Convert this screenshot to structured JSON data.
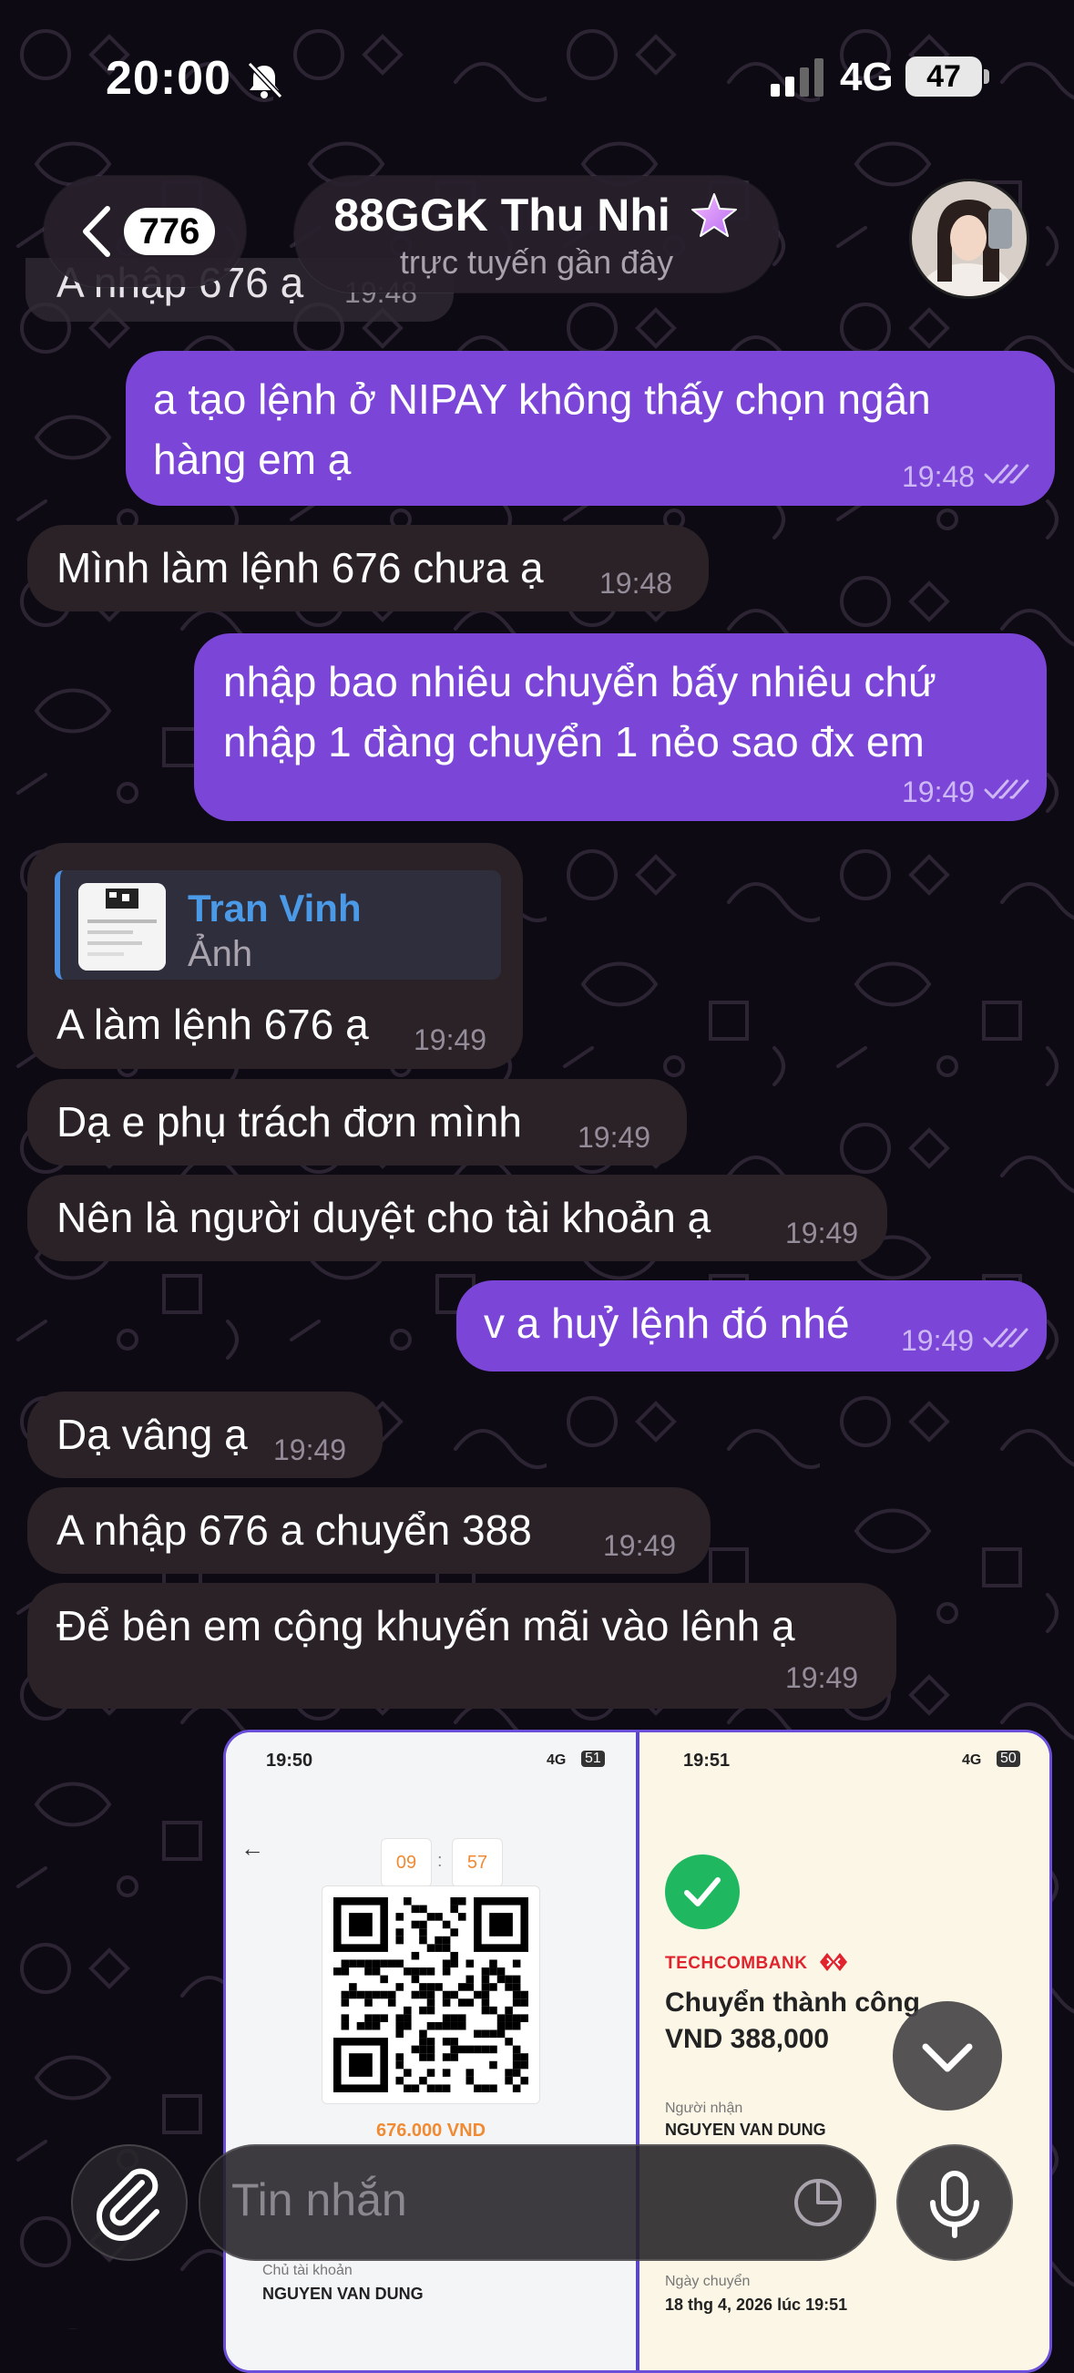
{
  "status_bar": {
    "time": "20:00",
    "network": "4G",
    "battery": "47"
  },
  "header": {
    "back_badge": "776",
    "title": "88GGK Thu Nhi",
    "subtitle": "trực tuyến gần đây"
  },
  "ghost_message": {
    "text": "A nhập 676 ạ",
    "time": "19:48"
  },
  "messages": [
    {
      "direction": "out",
      "line1": "a tạo lệnh ở NIPAY không thấy chọn ngân",
      "line2": "hàng em ạ",
      "time": "19:48"
    },
    {
      "direction": "in",
      "text": "Mình làm lệnh 676 chưa ạ",
      "time": "19:48"
    },
    {
      "direction": "out",
      "line1": "nhập bao nhiêu chuyển bấy nhiêu chứ",
      "line2": "nhập 1 đàng chuyển 1 nẻo sao đx em",
      "time": "19:49"
    },
    {
      "direction": "in",
      "text": "A làm lệnh 676 ạ",
      "time": "19:49",
      "reply": {
        "name": "Tran Vinh",
        "kind": "Ảnh"
      }
    },
    {
      "direction": "in",
      "text": "Dạ e phụ trách đơn mình",
      "time": "19:49"
    },
    {
      "direction": "in",
      "text": "Nên là người duyệt cho tài khoản ạ",
      "time": "19:49"
    },
    {
      "direction": "out",
      "text": "v a huỷ lệnh đó nhé",
      "time": "19:49"
    },
    {
      "direction": "in",
      "text": "Dạ vâng ạ",
      "time": "19:49"
    },
    {
      "direction": "in",
      "text": "A nhập 676 a chuyển 388",
      "time": "19:49"
    },
    {
      "direction": "in",
      "text": "Để bên em cộng khuyến mãi vào lênh ạ",
      "time": "19:49"
    }
  ],
  "media": {
    "left": {
      "time": "19:50",
      "network": "4G",
      "battery": "51",
      "timer_min": "09",
      "timer_sep": ":",
      "timer_sec": "57",
      "amount": "676.000 VND",
      "owner_label": "Chủ tài khoản",
      "owner_name": "NGUYEN VAN DUNG"
    },
    "right": {
      "time": "19:51",
      "network": "4G",
      "battery": "50",
      "bank": "TECHCOMBANK",
      "title": "Chuyển thành công",
      "amount": "VND 388,000",
      "recipient_label": "Người nhận",
      "recipient_name": "NGUYEN VAN DUNG",
      "date_label": "Ngày chuyển",
      "date_value": "18 thg 4, 2026 lúc 19:51"
    }
  },
  "input": {
    "placeholder": "Tin nhắn"
  },
  "colors": {
    "outgoing": "#7b46d8",
    "incoming": "#2a2227",
    "reply_accent": "#4a8fe0",
    "background": "#0d0a14"
  }
}
